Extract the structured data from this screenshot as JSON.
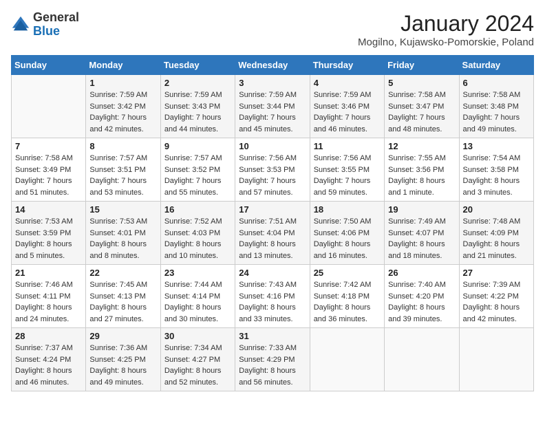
{
  "logo": {
    "general": "General",
    "blue": "Blue"
  },
  "title": "January 2024",
  "subtitle": "Mogilno, Kujawsko-Pomorskie, Poland",
  "weekdays": [
    "Sunday",
    "Monday",
    "Tuesday",
    "Wednesday",
    "Thursday",
    "Friday",
    "Saturday"
  ],
  "weeks": [
    [
      {
        "day": "",
        "sunrise": "",
        "sunset": "",
        "daylight": ""
      },
      {
        "day": "1",
        "sunrise": "Sunrise: 7:59 AM",
        "sunset": "Sunset: 3:42 PM",
        "daylight": "Daylight: 7 hours and 42 minutes."
      },
      {
        "day": "2",
        "sunrise": "Sunrise: 7:59 AM",
        "sunset": "Sunset: 3:43 PM",
        "daylight": "Daylight: 7 hours and 44 minutes."
      },
      {
        "day": "3",
        "sunrise": "Sunrise: 7:59 AM",
        "sunset": "Sunset: 3:44 PM",
        "daylight": "Daylight: 7 hours and 45 minutes."
      },
      {
        "day": "4",
        "sunrise": "Sunrise: 7:59 AM",
        "sunset": "Sunset: 3:46 PM",
        "daylight": "Daylight: 7 hours and 46 minutes."
      },
      {
        "day": "5",
        "sunrise": "Sunrise: 7:58 AM",
        "sunset": "Sunset: 3:47 PM",
        "daylight": "Daylight: 7 hours and 48 minutes."
      },
      {
        "day": "6",
        "sunrise": "Sunrise: 7:58 AM",
        "sunset": "Sunset: 3:48 PM",
        "daylight": "Daylight: 7 hours and 49 minutes."
      }
    ],
    [
      {
        "day": "7",
        "sunrise": "Sunrise: 7:58 AM",
        "sunset": "Sunset: 3:49 PM",
        "daylight": "Daylight: 7 hours and 51 minutes."
      },
      {
        "day": "8",
        "sunrise": "Sunrise: 7:57 AM",
        "sunset": "Sunset: 3:51 PM",
        "daylight": "Daylight: 7 hours and 53 minutes."
      },
      {
        "day": "9",
        "sunrise": "Sunrise: 7:57 AM",
        "sunset": "Sunset: 3:52 PM",
        "daylight": "Daylight: 7 hours and 55 minutes."
      },
      {
        "day": "10",
        "sunrise": "Sunrise: 7:56 AM",
        "sunset": "Sunset: 3:53 PM",
        "daylight": "Daylight: 7 hours and 57 minutes."
      },
      {
        "day": "11",
        "sunrise": "Sunrise: 7:56 AM",
        "sunset": "Sunset: 3:55 PM",
        "daylight": "Daylight: 7 hours and 59 minutes."
      },
      {
        "day": "12",
        "sunrise": "Sunrise: 7:55 AM",
        "sunset": "Sunset: 3:56 PM",
        "daylight": "Daylight: 8 hours and 1 minute."
      },
      {
        "day": "13",
        "sunrise": "Sunrise: 7:54 AM",
        "sunset": "Sunset: 3:58 PM",
        "daylight": "Daylight: 8 hours and 3 minutes."
      }
    ],
    [
      {
        "day": "14",
        "sunrise": "Sunrise: 7:53 AM",
        "sunset": "Sunset: 3:59 PM",
        "daylight": "Daylight: 8 hours and 5 minutes."
      },
      {
        "day": "15",
        "sunrise": "Sunrise: 7:53 AM",
        "sunset": "Sunset: 4:01 PM",
        "daylight": "Daylight: 8 hours and 8 minutes."
      },
      {
        "day": "16",
        "sunrise": "Sunrise: 7:52 AM",
        "sunset": "Sunset: 4:03 PM",
        "daylight": "Daylight: 8 hours and 10 minutes."
      },
      {
        "day": "17",
        "sunrise": "Sunrise: 7:51 AM",
        "sunset": "Sunset: 4:04 PM",
        "daylight": "Daylight: 8 hours and 13 minutes."
      },
      {
        "day": "18",
        "sunrise": "Sunrise: 7:50 AM",
        "sunset": "Sunset: 4:06 PM",
        "daylight": "Daylight: 8 hours and 16 minutes."
      },
      {
        "day": "19",
        "sunrise": "Sunrise: 7:49 AM",
        "sunset": "Sunset: 4:07 PM",
        "daylight": "Daylight: 8 hours and 18 minutes."
      },
      {
        "day": "20",
        "sunrise": "Sunrise: 7:48 AM",
        "sunset": "Sunset: 4:09 PM",
        "daylight": "Daylight: 8 hours and 21 minutes."
      }
    ],
    [
      {
        "day": "21",
        "sunrise": "Sunrise: 7:46 AM",
        "sunset": "Sunset: 4:11 PM",
        "daylight": "Daylight: 8 hours and 24 minutes."
      },
      {
        "day": "22",
        "sunrise": "Sunrise: 7:45 AM",
        "sunset": "Sunset: 4:13 PM",
        "daylight": "Daylight: 8 hours and 27 minutes."
      },
      {
        "day": "23",
        "sunrise": "Sunrise: 7:44 AM",
        "sunset": "Sunset: 4:14 PM",
        "daylight": "Daylight: 8 hours and 30 minutes."
      },
      {
        "day": "24",
        "sunrise": "Sunrise: 7:43 AM",
        "sunset": "Sunset: 4:16 PM",
        "daylight": "Daylight: 8 hours and 33 minutes."
      },
      {
        "day": "25",
        "sunrise": "Sunrise: 7:42 AM",
        "sunset": "Sunset: 4:18 PM",
        "daylight": "Daylight: 8 hours and 36 minutes."
      },
      {
        "day": "26",
        "sunrise": "Sunrise: 7:40 AM",
        "sunset": "Sunset: 4:20 PM",
        "daylight": "Daylight: 8 hours and 39 minutes."
      },
      {
        "day": "27",
        "sunrise": "Sunrise: 7:39 AM",
        "sunset": "Sunset: 4:22 PM",
        "daylight": "Daylight: 8 hours and 42 minutes."
      }
    ],
    [
      {
        "day": "28",
        "sunrise": "Sunrise: 7:37 AM",
        "sunset": "Sunset: 4:24 PM",
        "daylight": "Daylight: 8 hours and 46 minutes."
      },
      {
        "day": "29",
        "sunrise": "Sunrise: 7:36 AM",
        "sunset": "Sunset: 4:25 PM",
        "daylight": "Daylight: 8 hours and 49 minutes."
      },
      {
        "day": "30",
        "sunrise": "Sunrise: 7:34 AM",
        "sunset": "Sunset: 4:27 PM",
        "daylight": "Daylight: 8 hours and 52 minutes."
      },
      {
        "day": "31",
        "sunrise": "Sunrise: 7:33 AM",
        "sunset": "Sunset: 4:29 PM",
        "daylight": "Daylight: 8 hours and 56 minutes."
      },
      {
        "day": "",
        "sunrise": "",
        "sunset": "",
        "daylight": ""
      },
      {
        "day": "",
        "sunrise": "",
        "sunset": "",
        "daylight": ""
      },
      {
        "day": "",
        "sunrise": "",
        "sunset": "",
        "daylight": ""
      }
    ]
  ]
}
